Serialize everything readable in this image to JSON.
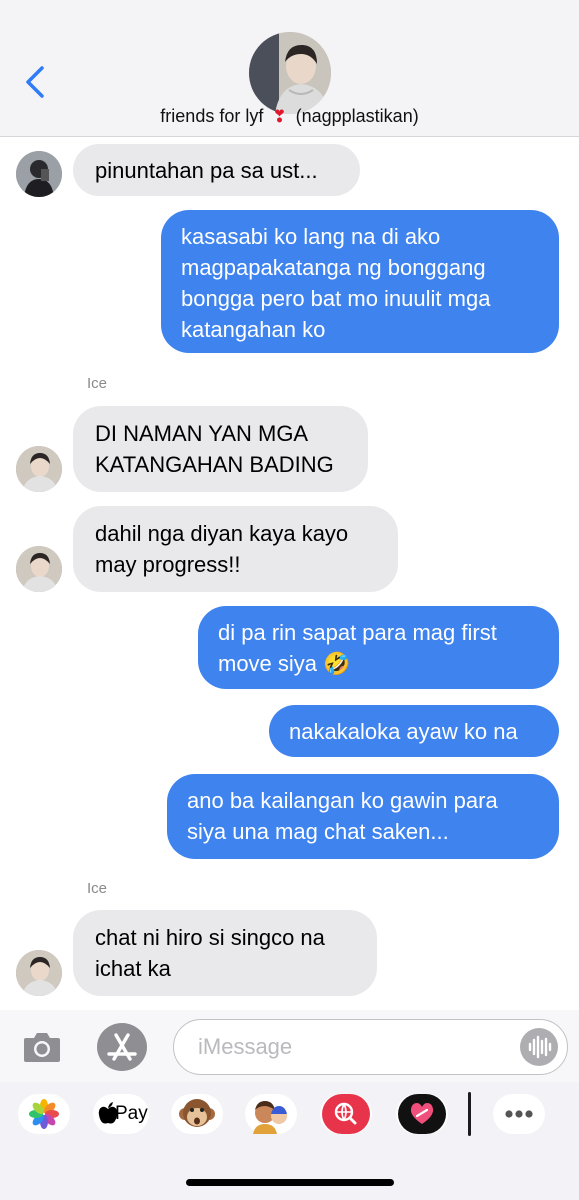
{
  "header": {
    "group_name": "friends for lyf",
    "group_note": "(nagpplastikan)"
  },
  "messages": [
    {
      "direction": "in",
      "text": "pinuntahan pa sa ust..."
    },
    {
      "direction": "out",
      "lines": [
        "kasasabi ko lang na di ako",
        "magpapakatanga ng bonggang",
        "bongga pero bat mo inuulit mga",
        "katangahan ko"
      ]
    },
    {
      "sender": "Ice"
    },
    {
      "direction": "in",
      "lines": [
        "DI NAMAN YAN MGA",
        "KATANGAHAN BADING"
      ]
    },
    {
      "direction": "in",
      "lines": [
        "dahil nga diyan kaya kayo",
        "may progress!!"
      ]
    },
    {
      "direction": "out",
      "lines": [
        "di pa rin sapat para mag first",
        "move siya"
      ],
      "emoji": "🤣"
    },
    {
      "direction": "out",
      "text": "nakakaloka ayaw ko na"
    },
    {
      "direction": "out",
      "lines": [
        "ano ba kailangan ko gawin para",
        "siya una mag chat saken..."
      ]
    },
    {
      "sender": "Ice"
    },
    {
      "direction": "in",
      "lines": [
        "chat ni hiro si singco na",
        "ichat ka"
      ]
    }
  ],
  "compose": {
    "placeholder": "iMessage"
  },
  "app_drawer": {
    "apple_pay_label": "Pay",
    "items": [
      "photos-app",
      "apple-pay",
      "memoji-monkey",
      "memoji-group",
      "search-images",
      "digital-touch",
      "more"
    ]
  },
  "colors": {
    "outgoing_bubble": "#3e83ee",
    "incoming_bubble": "#e9e9eb",
    "accent": "#2f7cf6"
  }
}
